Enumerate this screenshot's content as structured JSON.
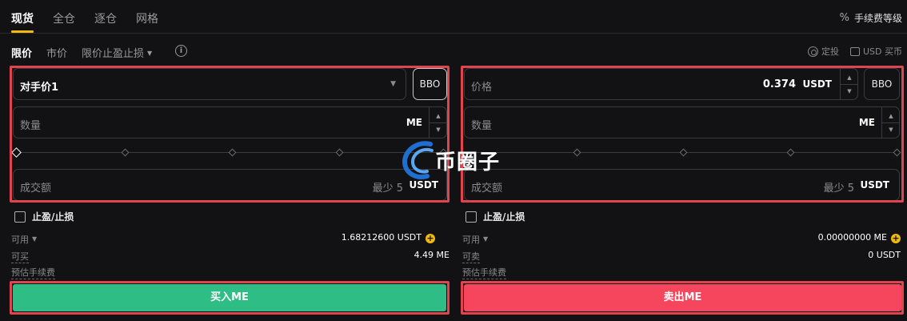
{
  "top_tabs": [
    "现货",
    "全仓",
    "逐仓",
    "网格"
  ],
  "fee_level": "手续费等级",
  "order_types": {
    "limit": "限价",
    "market": "市价",
    "tpsl": "限价止盈止损"
  },
  "tools": {
    "dca": "定投",
    "usd_buy": "USD 买币"
  },
  "buy": {
    "counter_price": "对手价1",
    "bbo": "BBO",
    "qty_label": "数量",
    "qty_unit": "ME",
    "amount_label": "成交额",
    "amount_min": "最少 5",
    "amount_unit": "USDT",
    "tpsl_label": "止盈/止损",
    "avail_label": "可用",
    "avail_value": "1.68212600 USDT",
    "can_label": "可买",
    "can_value": "4.49 ME",
    "fee_label": "预估手续费",
    "button": "买入ME"
  },
  "sell": {
    "price_label": "价格",
    "price_value": "0.374",
    "price_unit": "USDT",
    "bbo": "BBO",
    "qty_label": "数量",
    "qty_unit": "ME",
    "amount_label": "成交额",
    "amount_min": "最少 5",
    "amount_unit": "USDT",
    "tpsl_label": "止盈/止损",
    "avail_label": "可用",
    "avail_value": "0.00000000 ME",
    "can_label": "可卖",
    "can_value": "0 USDT",
    "fee_label": "预估手续费",
    "button": "卖出ME"
  },
  "watermark": "币圈子",
  "colors": {
    "accent": "#f0b90b",
    "buy": "#2ebd85",
    "sell": "#f6465d",
    "highlight": "#e0454f"
  }
}
